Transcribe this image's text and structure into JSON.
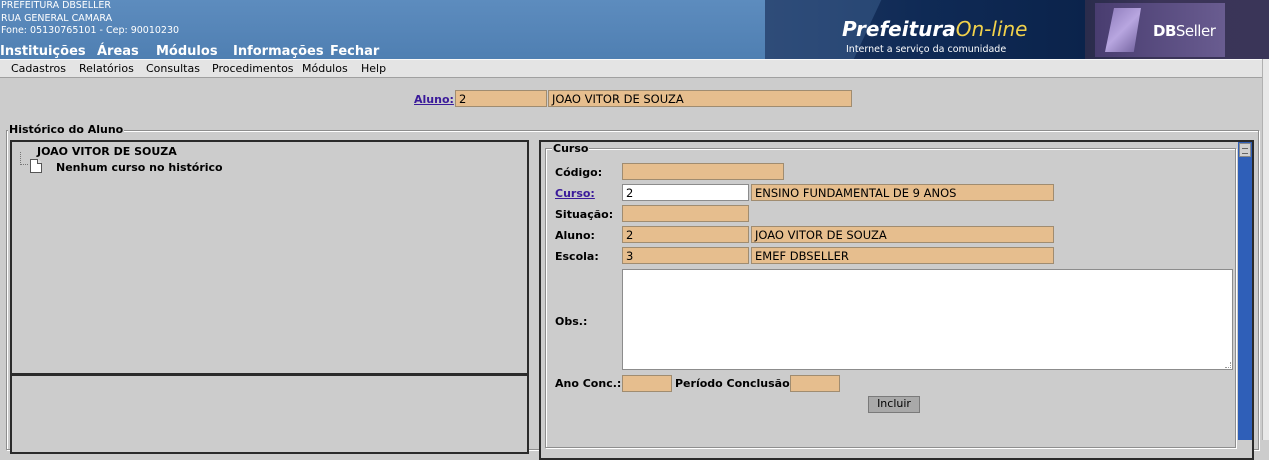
{
  "header": {
    "institution_name": "PREFEITURA DBSELLER",
    "address": "RUA GENERAL CAMARA",
    "contact": "Fone: 05130765101  -  Cep: 90010230",
    "main_menu": [
      "Instituições",
      "Áreas",
      "Módulos",
      "Informações",
      "Fechar"
    ],
    "logo_brand": "Prefeitura",
    "logo_brand_accent": "On-line",
    "logo_tagline": "Internet a serviço da comunidade",
    "logo_dbseller_bold": "DB",
    "logo_dbseller_rest": "Seller"
  },
  "menubar": [
    "Cadastros",
    "Relatórios",
    "Consultas",
    "Procedimentos",
    "Módulos",
    "Help"
  ],
  "top_student": {
    "label": "Aluno:",
    "code": "2",
    "name": "JOAO VITOR DE SOUZA"
  },
  "historico": {
    "legend": "Histórico do Aluno",
    "tree_root": "JOAO VITOR DE SOUZA",
    "tree_item": "Nenhum curso no histórico"
  },
  "curso_form": {
    "legend": "Curso",
    "codigo_label": "Código:",
    "codigo_value": "",
    "curso_label": "Curso:",
    "curso_code": "2",
    "curso_name": "ENSINO FUNDAMENTAL DE 9 ANOS",
    "situacao_label": "Situação:",
    "situacao_value": "",
    "aluno_label": "Aluno:",
    "aluno_code": "2",
    "aluno_name": "JOAO VITOR DE SOUZA",
    "escola_label": "Escola:",
    "escola_code": "3",
    "escola_name": "EMEF DBSELLER",
    "obs_label": "Obs.:",
    "obs_value": "",
    "ano_conc_label": "Ano Conc.:",
    "ano_conc_value": "",
    "periodo_label": "Período Conclusão:",
    "periodo_value": "",
    "include_button": "Incluir"
  },
  "colors": {
    "header_blue": "#5d8cbe",
    "readonly_field": "#e6be8e",
    "background": "#cccccc",
    "link": "#3a1a9a"
  }
}
